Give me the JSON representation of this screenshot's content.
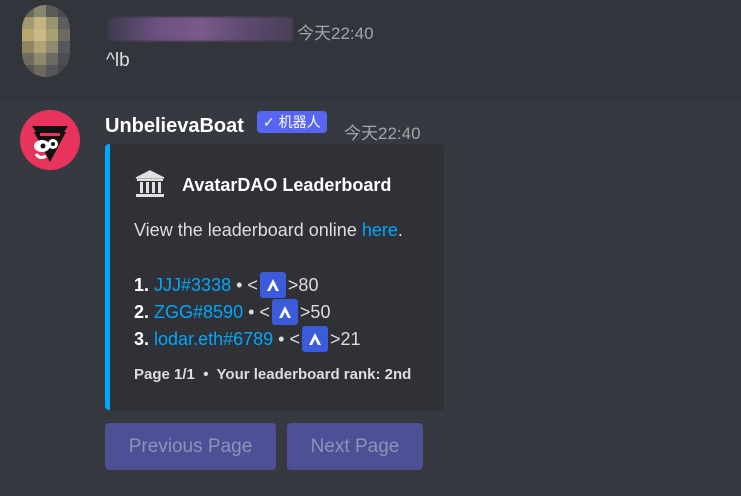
{
  "message1": {
    "timestamp": "今天22:40",
    "content": "^lb"
  },
  "message2": {
    "author": "UnbelievaBoat",
    "bot_tag": "✓ 机器人",
    "timestamp": "今天22:40",
    "embed": {
      "icon": "bank-icon",
      "title": "AvatarDAO Leaderboard",
      "description_prefix": "View the leaderboard online ",
      "description_link": "here",
      "description_suffix": ".",
      "entries": [
        {
          "rank": "1.",
          "user": "JJJ#3338",
          "sep": " • <",
          "amount": ">80"
        },
        {
          "rank": "2.",
          "user": "ZGG#8590",
          "sep": " • <",
          "amount": ">50"
        },
        {
          "rank": "3.",
          "user": "lodar.eth#6789",
          "sep": " • <",
          "amount": ">21"
        }
      ],
      "footer": "Page 1/1  •  Your leaderboard rank: 2nd"
    },
    "buttons": {
      "previous": "Previous Page",
      "next": "Next Page"
    }
  },
  "colors": {
    "link": "#00a8fc",
    "accent": "#5865f2",
    "embed_border": "#00a8fc"
  }
}
